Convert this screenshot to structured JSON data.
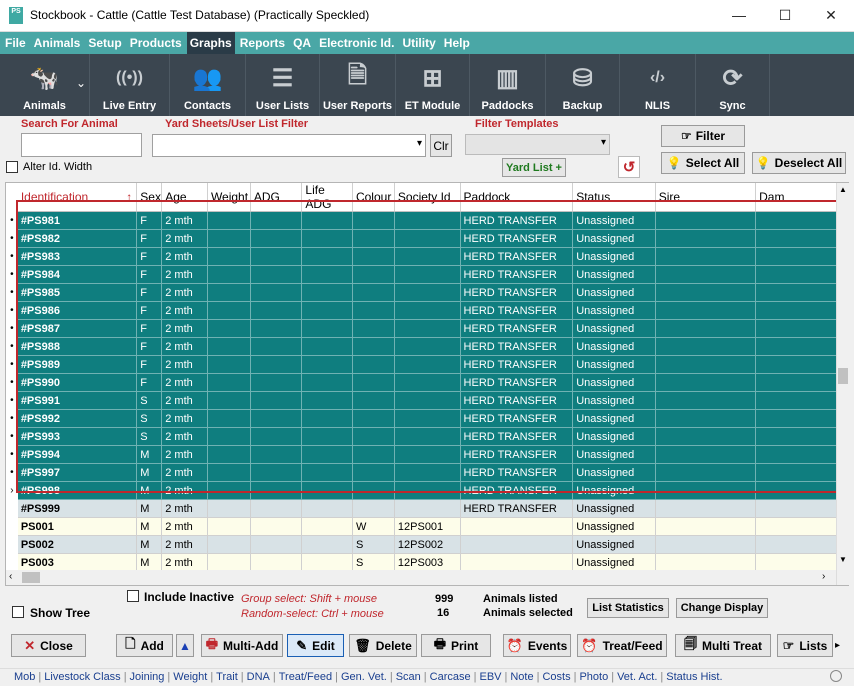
{
  "window": {
    "icon": "PS",
    "title": "Stockbook - Cattle (Cattle Test Database) (Practically Speckled)",
    "min": "—",
    "max": "☐",
    "close": "✕"
  },
  "menu": [
    "File",
    "Animals",
    "Setup",
    "Products",
    "Graphs",
    "Reports",
    "QA",
    "Electronic Id.",
    "Utility",
    "Help"
  ],
  "toolbar": [
    {
      "label": "Animals",
      "icon": "cow-icon",
      "glyph": "🐄"
    },
    {
      "label": "Live Entry",
      "icon": "signal-icon",
      "glyph": "((•))"
    },
    {
      "label": "Contacts",
      "icon": "people-icon",
      "glyph": "👥"
    },
    {
      "label": "User Lists",
      "icon": "list-icon",
      "glyph": "☰"
    },
    {
      "label": "User Reports",
      "icon": "report-icon",
      "glyph": "🗎"
    },
    {
      "label": "ET Module",
      "icon": "tree-icon",
      "glyph": "⊞"
    },
    {
      "label": "Paddocks",
      "icon": "fence-icon",
      "glyph": "▥"
    },
    {
      "label": "Backup",
      "icon": "database-icon",
      "glyph": "⛁"
    },
    {
      "label": "NLIS",
      "icon": "nlis-icon",
      "glyph": "‹/›"
    },
    {
      "label": "Sync",
      "icon": "sync-icon",
      "glyph": "⟳"
    }
  ],
  "filters": {
    "search_label": "Search For Animal",
    "yard_label": "Yard Sheets/User List Filter",
    "templates_label": "Filter Templates",
    "clr": "Clr",
    "yard_list": "Yard List +",
    "alter_id": "Alter Id. Width",
    "filter": "Filter",
    "select_all": "Select All",
    "deselect_all": "Deselect All"
  },
  "columns": [
    "Identification",
    "Sex",
    "Age",
    "Weight",
    "ADG",
    "Life ADG",
    "Colour",
    "Society Id",
    "Paddock",
    "Status",
    "Sire",
    "Dam"
  ],
  "sort_arrow": "↑",
  "rows": [
    {
      "ind": "•",
      "id": "#PS981",
      "sex": "F",
      "age": "2 mth",
      "colour": "",
      "society": "",
      "paddock": "HERD TRANSFER",
      "status": "Unassigned",
      "style": "sel"
    },
    {
      "ind": "•",
      "id": "#PS982",
      "sex": "F",
      "age": "2 mth",
      "colour": "",
      "society": "",
      "paddock": "HERD TRANSFER",
      "status": "Unassigned",
      "style": "sel"
    },
    {
      "ind": "•",
      "id": "#PS983",
      "sex": "F",
      "age": "2 mth",
      "colour": "",
      "society": "",
      "paddock": "HERD TRANSFER",
      "status": "Unassigned",
      "style": "sel"
    },
    {
      "ind": "•",
      "id": "#PS984",
      "sex": "F",
      "age": "2 mth",
      "colour": "",
      "society": "",
      "paddock": "HERD TRANSFER",
      "status": "Unassigned",
      "style": "sel"
    },
    {
      "ind": "•",
      "id": "#PS985",
      "sex": "F",
      "age": "2 mth",
      "colour": "",
      "society": "",
      "paddock": "HERD TRANSFER",
      "status": "Unassigned",
      "style": "sel"
    },
    {
      "ind": "•",
      "id": "#PS986",
      "sex": "F",
      "age": "2 mth",
      "colour": "",
      "society": "",
      "paddock": "HERD TRANSFER",
      "status": "Unassigned",
      "style": "sel"
    },
    {
      "ind": "•",
      "id": "#PS987",
      "sex": "F",
      "age": "2 mth",
      "colour": "",
      "society": "",
      "paddock": "HERD TRANSFER",
      "status": "Unassigned",
      "style": "sel"
    },
    {
      "ind": "•",
      "id": "#PS988",
      "sex": "F",
      "age": "2 mth",
      "colour": "",
      "society": "",
      "paddock": "HERD TRANSFER",
      "status": "Unassigned",
      "style": "sel"
    },
    {
      "ind": "•",
      "id": "#PS989",
      "sex": "F",
      "age": "2 mth",
      "colour": "",
      "society": "",
      "paddock": "HERD TRANSFER",
      "status": "Unassigned",
      "style": "sel"
    },
    {
      "ind": "•",
      "id": "#PS990",
      "sex": "F",
      "age": "2 mth",
      "colour": "",
      "society": "",
      "paddock": "HERD TRANSFER",
      "status": "Unassigned",
      "style": "sel"
    },
    {
      "ind": "•",
      "id": "#PS991",
      "sex": "S",
      "age": "2 mth",
      "colour": "",
      "society": "",
      "paddock": "HERD TRANSFER",
      "status": "Unassigned",
      "style": "sel"
    },
    {
      "ind": "•",
      "id": "#PS992",
      "sex": "S",
      "age": "2 mth",
      "colour": "",
      "society": "",
      "paddock": "HERD TRANSFER",
      "status": "Unassigned",
      "style": "sel"
    },
    {
      "ind": "•",
      "id": "#PS993",
      "sex": "S",
      "age": "2 mth",
      "colour": "",
      "society": "",
      "paddock": "HERD TRANSFER",
      "status": "Unassigned",
      "style": "sel"
    },
    {
      "ind": "•",
      "id": "#PS994",
      "sex": "M",
      "age": "2 mth",
      "colour": "",
      "society": "",
      "paddock": "HERD TRANSFER",
      "status": "Unassigned",
      "style": "sel"
    },
    {
      "ind": "•",
      "id": "#PS997",
      "sex": "M",
      "age": "2 mth",
      "colour": "",
      "society": "",
      "paddock": "HERD TRANSFER",
      "status": "Unassigned",
      "style": "sel"
    },
    {
      "ind": "›",
      "id": "#PS998",
      "sex": "M",
      "age": "2 mth",
      "colour": "",
      "society": "",
      "paddock": "HERD TRANSFER",
      "status": "Unassigned",
      "style": "sel"
    },
    {
      "ind": "",
      "id": "#PS999",
      "sex": "M",
      "age": "2 mth",
      "colour": "",
      "society": "",
      "paddock": "HERD TRANSFER",
      "status": "Unassigned",
      "style": "grey"
    },
    {
      "ind": "",
      "id": "PS001",
      "sex": "M",
      "age": "2 mth",
      "colour": "W",
      "society": "12PS001",
      "paddock": "",
      "status": "Unassigned",
      "style": "yel"
    },
    {
      "ind": "",
      "id": "PS002",
      "sex": "M",
      "age": "2 mth",
      "colour": "S",
      "society": "12PS002",
      "paddock": "",
      "status": "Unassigned",
      "style": "grey"
    },
    {
      "ind": "",
      "id": "PS003",
      "sex": "M",
      "age": "2 mth",
      "colour": "S",
      "society": "12PS003",
      "paddock": "",
      "status": "Unassigned",
      "style": "yel"
    }
  ],
  "status": {
    "include_inactive": "Include Inactive",
    "show_tree": "Show Tree",
    "group_select": "Group select: Shift + mouse",
    "random_select": "Random-select: Ctrl + mouse",
    "listed_count": "999",
    "listed_label": "Animals listed",
    "selected_count": "16",
    "selected_label": "Animals selected",
    "list_stats": "List Statistics",
    "change_display": "Change Display"
  },
  "actions": [
    "Close",
    "Add",
    "Multi-Add",
    "Edit",
    "Delete",
    "Print",
    "Events",
    "Treat/Feed",
    "Multi Treat",
    "Lists"
  ],
  "bottom_links": [
    "Mob",
    "Livestock Class",
    "Joining",
    "Weight",
    "Trait",
    "DNA",
    "Treat/Feed",
    "Gen. Vet.",
    "Scan",
    "Carcase",
    "EBV",
    "Note",
    "Costs",
    "Photo",
    "Vet. Act.",
    "Status Hist."
  ]
}
